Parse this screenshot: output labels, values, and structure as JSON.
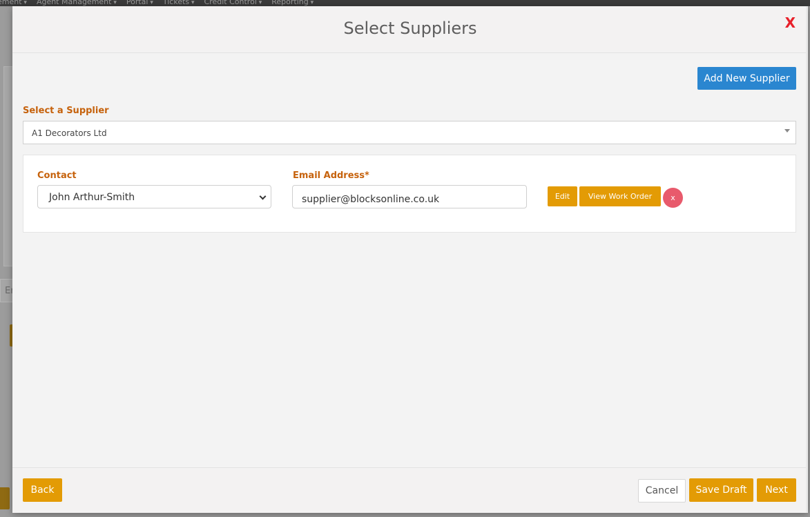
{
  "background": {
    "nav_items": [
      "ement",
      "Agent Management",
      "Portal",
      "Tickets",
      "Credit Control",
      "Reporting"
    ],
    "input_fragment": "Er"
  },
  "modal": {
    "title": "Select Suppliers",
    "close_label": "X",
    "add_new_label": "Add New Supplier",
    "supplier_select": {
      "label": "Select a Supplier",
      "value": "A1 Decorators Ltd"
    },
    "contact": {
      "label": "Contact",
      "value": "John Arthur-Smith"
    },
    "email": {
      "label": "Email Address",
      "required_mark": "*",
      "value": "supplier@blocksonline.co.uk"
    },
    "edit_label": "Edit",
    "view_work_order_label": "View Work Order",
    "remove_label": "x"
  },
  "footer": {
    "back_label": "Back",
    "cancel_label": "Cancel",
    "save_draft_label": "Save Draft",
    "next_label": "Next"
  },
  "colors": {
    "accent_blue": "#2a86d0",
    "gold": "#e39b05",
    "label_orange": "#c6620c",
    "close_red": "#e8202a",
    "remove_pink": "#e85a6c"
  }
}
